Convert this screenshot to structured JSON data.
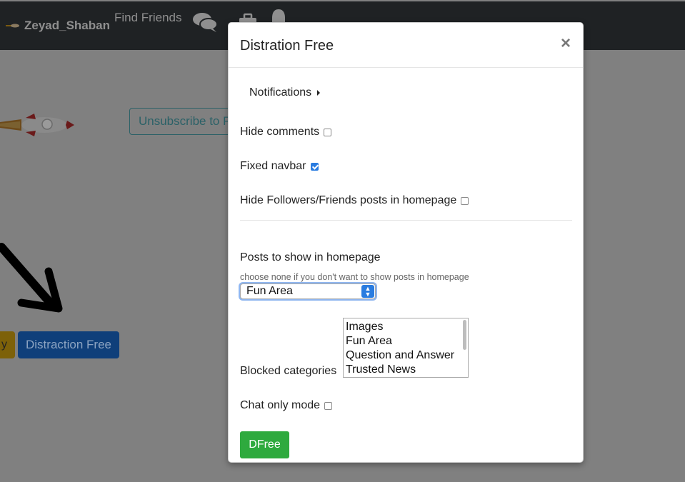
{
  "navbar": {
    "username": "Zeyad_Shaban",
    "find_friends": "Find Friends",
    "icons": [
      "chat-icon",
      "briefcase-icon",
      "bell-icon"
    ]
  },
  "background": {
    "unsubscribe_label": "Unsubscribe to P",
    "yellow_button_label": "y",
    "distraction_button_label": "Distraction Free"
  },
  "modal": {
    "title": "Distration Free",
    "close_glyph": "×",
    "notifications_label": "Notifications",
    "hide_comments": {
      "label": "Hide comments",
      "checked": false
    },
    "fixed_navbar": {
      "label": "Fixed navbar",
      "checked": true
    },
    "hide_followers": {
      "label": "Hide Followers/Friends posts in homepage",
      "checked": false
    },
    "posts_label": "Posts to show in homepage",
    "posts_hint": "choose none if you don't want to show posts in homepage",
    "posts_selected": "Fun Area",
    "blocked_label": "Blocked categories",
    "blocked_options": [
      "Images",
      "Fun Area",
      "Question and Answer",
      "Trusted News"
    ],
    "chat_only": {
      "label": "Chat only mode",
      "checked": false
    },
    "submit_label": "DFree"
  },
  "colors": {
    "navbar_bg": "#1f2224",
    "overlay_bg": "#808080",
    "checkbox_checked": "#2a7ce0",
    "submit_bg": "#2eaa3e"
  }
}
